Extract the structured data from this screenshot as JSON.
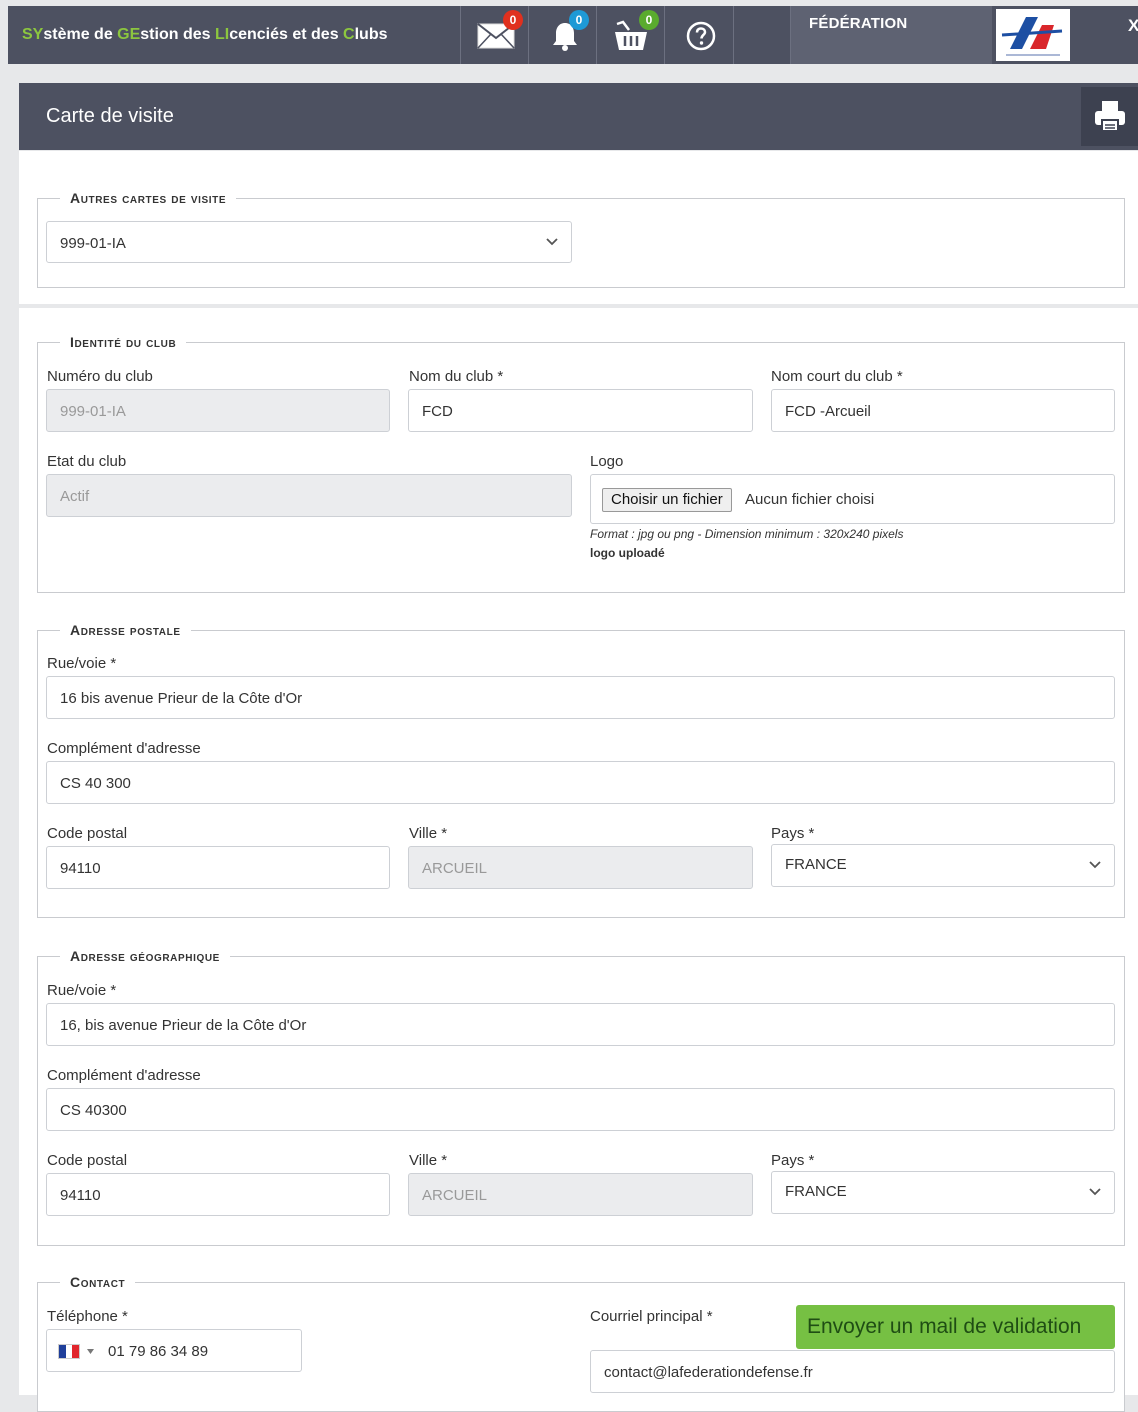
{
  "header": {
    "app_title_parts": [
      {
        "text": "SY",
        "hl": true
      },
      {
        "text": "stème de ",
        "hl": false
      },
      {
        "text": "GE",
        "hl": true
      },
      {
        "text": "stion des ",
        "hl": false
      },
      {
        "text": "LI",
        "hl": true
      },
      {
        "text": "cenciés et des ",
        "hl": false
      },
      {
        "text": "C",
        "hl": true
      },
      {
        "text": "lubs",
        "hl": false
      }
    ],
    "mail_count": "0",
    "notif_count": "0",
    "cart_count": "0",
    "federation_label": "FÉDÉRATION",
    "close_label": "X",
    "colors": {
      "bar": "#4d5161",
      "accent": "#8cc63f",
      "mail_badge": "#e0301e",
      "notif_badge": "#1e9ad6",
      "cart_badge": "#5aab2e"
    }
  },
  "page": {
    "title": "Carte de visite"
  },
  "autres_cartes": {
    "legend": "Autres cartes de visite",
    "selected": "999-01-IA"
  },
  "identite": {
    "legend": "Identité du club",
    "numero_label": "Numéro du club",
    "numero_value": "999-01-IA",
    "nom_label": "Nom du club *",
    "nom_value": "FCD",
    "nom_court_label": "Nom court du club *",
    "nom_court_value": "FCD -Arcueil",
    "etat_label": "Etat du club",
    "etat_value": "Actif",
    "logo_label": "Logo",
    "file_button": "Choisir un fichier",
    "file_status": "Aucun fichier choisi",
    "format_hint": "Format : jpg ou png - Dimension minimum : 320x240 pixels",
    "upload_status": "logo uploadé"
  },
  "adresse_postale": {
    "legend": "Adresse postale",
    "rue_label": "Rue/voie *",
    "rue_value": "16 bis avenue Prieur de la Côte d'Or",
    "complement_label": "Complément d'adresse",
    "complement_value": "CS 40 300",
    "cp_label": "Code postal",
    "cp_value": "94110",
    "ville_label": "Ville *",
    "ville_value": "ARCUEIL",
    "pays_label": "Pays *",
    "pays_value": "FRANCE"
  },
  "adresse_geo": {
    "legend": "Adresse géographique",
    "rue_label": "Rue/voie *",
    "rue_value": "16, bis avenue Prieur de la Côte d'Or",
    "complement_label": "Complément d'adresse",
    "complement_value": "CS 40300",
    "cp_label": "Code postal",
    "cp_value": "94110",
    "ville_label": "Ville *",
    "ville_value": "ARCUEIL",
    "pays_label": "Pays *",
    "pays_value": "FRANCE"
  },
  "contact": {
    "legend": "Contact",
    "tel_label": "Téléphone *",
    "tel_value": "01 79 86 34 89",
    "email_label": "Courriel principal *",
    "email_value": "contact@lafederationdefense.fr",
    "send_button": "Envoyer un mail de validation"
  }
}
